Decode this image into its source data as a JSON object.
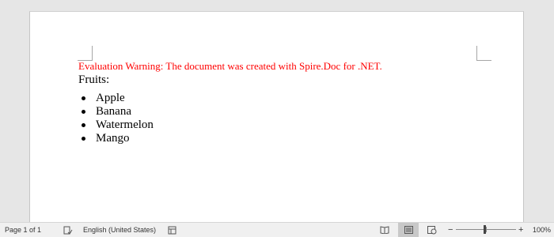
{
  "document": {
    "warning": "Evaluation Warning: The document was created with Spire.Doc for .NET.",
    "heading": "Fruits:",
    "items": [
      "Apple",
      "Banana",
      "Watermelon",
      "Mango"
    ]
  },
  "statusbar": {
    "page_info": "Page 1 of 1",
    "language": "English (United States)",
    "zoom_out": "−",
    "zoom_in": "+",
    "zoom": "100%",
    "zoom_fraction": 0.5
  },
  "colors": {
    "warning": "#ff0000",
    "canvas": "#e6e6e6",
    "statusbar": "#f0f0f0"
  },
  "icons": [
    "proofing-icon",
    "macro-icon",
    "read-mode-icon",
    "print-layout-icon",
    "web-layout-icon"
  ]
}
